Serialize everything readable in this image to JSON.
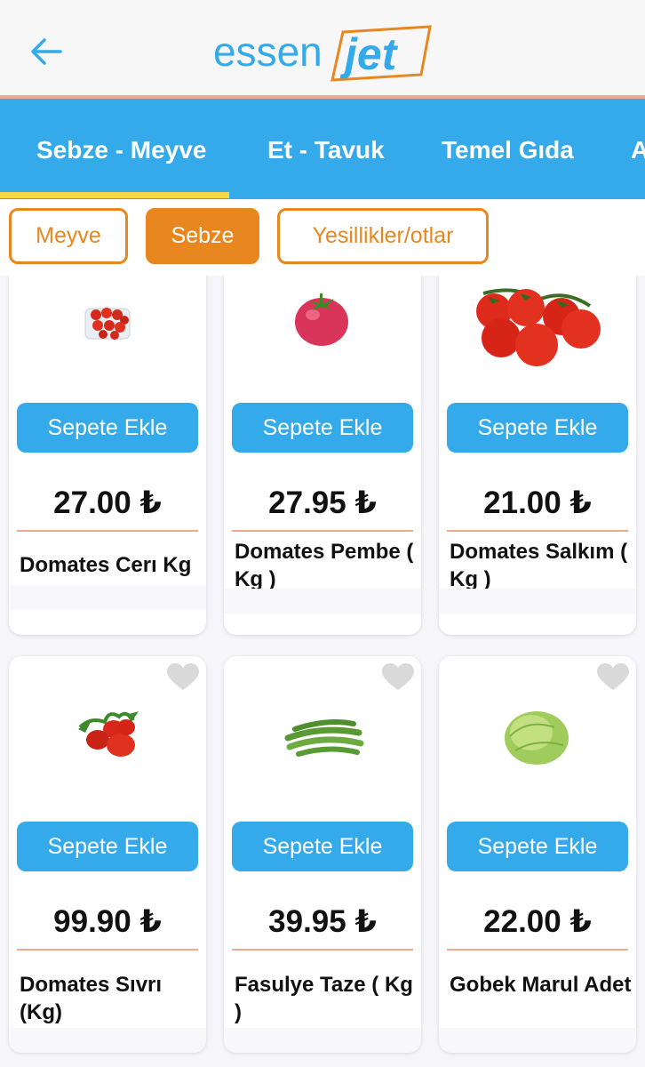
{
  "header": {
    "back_icon": "arrow-left-icon",
    "logo_part1": "essen",
    "logo_part2": "jet"
  },
  "colors": {
    "primary_blue": "#35aaea",
    "accent_orange": "#e8861f",
    "indicator_yellow": "#f5d84a"
  },
  "tabs": [
    {
      "label": "Sebze - Meyve",
      "active": true
    },
    {
      "label": "Et - Tavuk"
    },
    {
      "label": "Temel Gıda"
    },
    {
      "label": "A"
    }
  ],
  "chips": [
    {
      "label": "Meyve"
    },
    {
      "label": "Sebze",
      "active": true
    },
    {
      "label": "Yesillikler/otlar"
    }
  ],
  "products": [
    {
      "name": "Domates Cerı Kg",
      "price": "27.00 ₺",
      "button": "Sepete Ekle",
      "image": "cherry-tomato-pack-image"
    },
    {
      "name": "Domates Pembe ( Kg )",
      "price": "27.95 ₺",
      "button": "Sepete Ekle",
      "image": "pink-tomato-image"
    },
    {
      "name": "Domates Salkım ( Kg )",
      "price": "21.00 ₺",
      "button": "Sepete Ekle",
      "image": "vine-tomatoes-image"
    },
    {
      "name": "Domates Sıvrı (Kg)",
      "price": "99.90 ₺",
      "button": "Sepete Ekle",
      "image": "plum-tomatoes-image",
      "favorite_icon": "heart-icon"
    },
    {
      "name": "Fasulye Taze ( Kg )",
      "price": "39.95 ₺",
      "button": "Sepete Ekle",
      "image": "green-beans-image",
      "favorite_icon": "heart-icon"
    },
    {
      "name": "Gobek Marul Adet",
      "price": "22.00 ₺",
      "button": "Sepete Ekle",
      "image": "iceberg-lettuce-image",
      "favorite_icon": "heart-icon"
    }
  ]
}
